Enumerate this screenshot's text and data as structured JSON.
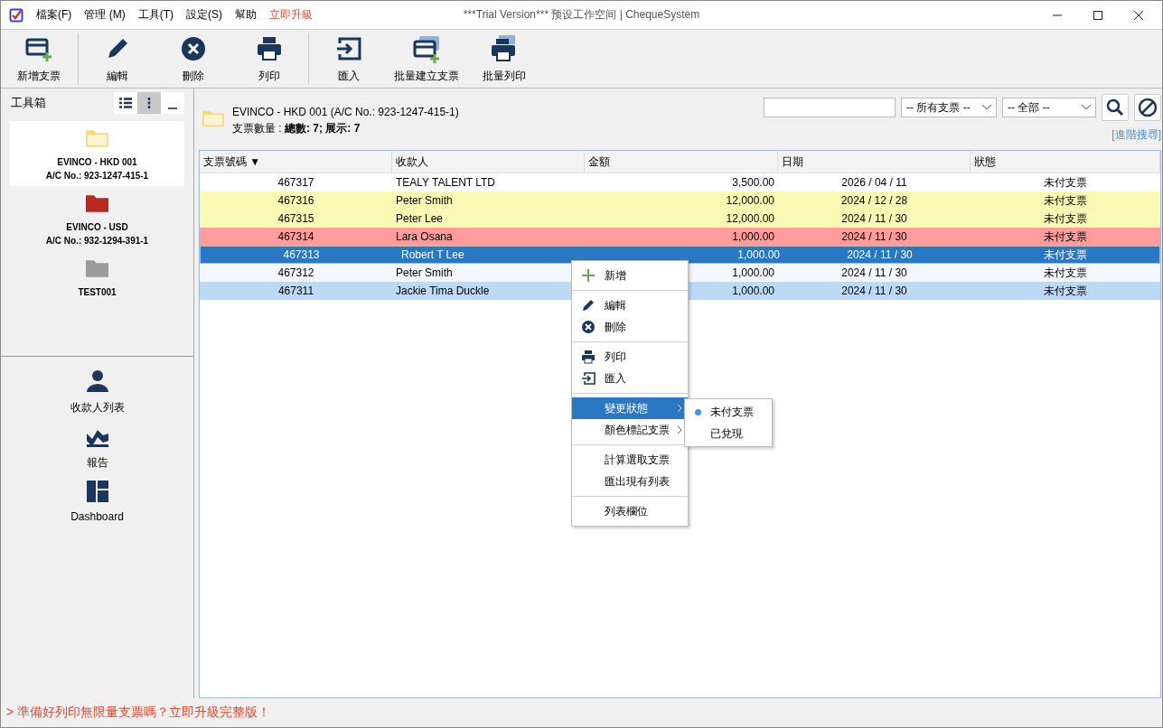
{
  "window": {
    "title": "***Trial Version*** 预设工作空间 | ChequeSystem"
  },
  "menu_bar": [
    {
      "label": "檔案(F)",
      "kind": "menu"
    },
    {
      "label": "管理 (M)",
      "kind": "menu"
    },
    {
      "label": "工具(T)",
      "kind": "menu"
    },
    {
      "label": "設定(S)",
      "kind": "menu"
    },
    {
      "label": "幫助",
      "kind": "menu"
    },
    {
      "label": "立即升級",
      "kind": "promo"
    }
  ],
  "toolbar": [
    [
      {
        "label": "新增支票"
      }
    ],
    [
      {
        "label": "編輯"
      },
      {
        "label": "刪除"
      },
      {
        "label": "列印"
      }
    ],
    [
      {
        "label": "匯入"
      },
      {
        "label": "批量建立支票"
      },
      {
        "label": "批量列印"
      }
    ]
  ],
  "sidebar": {
    "title": "工具箱",
    "view_buttons": [
      {
        "selected": false
      },
      {
        "selected": true
      }
    ],
    "accounts": [
      {
        "name": "EVINCO - HKD 001",
        "account": "A/C No.: 923-1247-415-1",
        "color": "#fad97a",
        "selected": true
      },
      {
        "name": "EVINCO - USD",
        "account": "A/C No.: 932-1294-391-1",
        "color": "#b8281f",
        "selected": false
      },
      {
        "name": "TEST001",
        "color": "#9b9b9b",
        "selected": false
      }
    ],
    "nav": [
      {
        "label": "收款人列表"
      },
      {
        "label": "報告"
      },
      {
        "label": "Dashboard"
      }
    ]
  },
  "header": {
    "title": "EVINCO - HKD 001 (A/C No.: 923-1247-415-1)",
    "count": "支票數量 : **總數: 7; 展示: 7**"
  },
  "filters": {
    "type_select": "-- 所有支票 --",
    "status_select": "-- 全部  --",
    "advanced_link": "[進階搜尋]"
  },
  "table": {
    "columns": [
      "支票號碼 ▼",
      "收款人",
      "金額",
      "日期",
      "狀態"
    ],
    "rows": [
      {
        "cells": [
          "467317",
          "TEALY TALENT LTD",
          "3,500.00",
          "2026 / 04 / 11",
          "未付支票"
        ],
        "color": "#ffffff",
        "selected": false
      },
      {
        "cells": [
          "467316",
          "Peter Smith",
          "12,000.00",
          "2024 / 12 / 28",
          "未付支票"
        ],
        "color": "#faf9b4",
        "selected": false
      },
      {
        "cells": [
          "467315",
          "Peter Lee",
          "12,000.00",
          "2024 / 11 / 30",
          "未付支票"
        ],
        "color": "#faf9b4",
        "selected": false
      },
      {
        "cells": [
          "467314",
          "Lara Osana",
          "1,000.00",
          "2024 / 11 / 30",
          "未付支票"
        ],
        "color": "#fe9c9c",
        "selected": false
      },
      {
        "cells": [
          "467313",
          "Robert T Lee",
          "1,000.00",
          "2024 / 11 / 30",
          "未付支票"
        ],
        "selected": true
      },
      {
        "cells": [
          "467312",
          "Peter Smith",
          "1,000.00",
          "2024 / 11 / 30",
          "未付支票"
        ],
        "color": "#f4f7fb",
        "selected": false
      },
      {
        "cells": [
          "467311",
          "Jackie Tima Duckle",
          "1,000.00",
          "2024 / 11 / 30",
          "未付支票"
        ],
        "color": "#bcdaf6",
        "selected": false
      }
    ]
  },
  "context_menu": {
    "groups": [
      [
        {
          "label": "新增",
          "kind": "action",
          "highlighted": false
        }
      ],
      [
        {
          "label": "編輯",
          "kind": "action",
          "highlighted": false
        },
        {
          "label": "刪除",
          "kind": "action",
          "highlighted": false
        }
      ],
      [
        {
          "label": "列印",
          "kind": "action",
          "highlighted": false
        },
        {
          "label": "匯入",
          "kind": "action",
          "highlighted": false
        }
      ],
      [
        {
          "label": "變更狀態",
          "kind": "submenu",
          "highlighted": true
        },
        {
          "label": "顏色標記支票",
          "kind": "submenu",
          "highlighted": false
        }
      ],
      [
        {
          "label": "計算選取支票",
          "kind": "action",
          "highlighted": false
        },
        {
          "label": "匯出現有列表",
          "kind": "action",
          "highlighted": false
        }
      ],
      [
        {
          "label": "列表欄位",
          "kind": "action",
          "highlighted": false
        }
      ]
    ],
    "submenu": [
      {
        "label": "未付支票",
        "selected": true
      },
      {
        "label": "已兌現",
        "selected": false
      }
    ]
  },
  "status_bar": {
    "message": "> 準備好列印無限量支票嗎？立即升級完整版！"
  }
}
